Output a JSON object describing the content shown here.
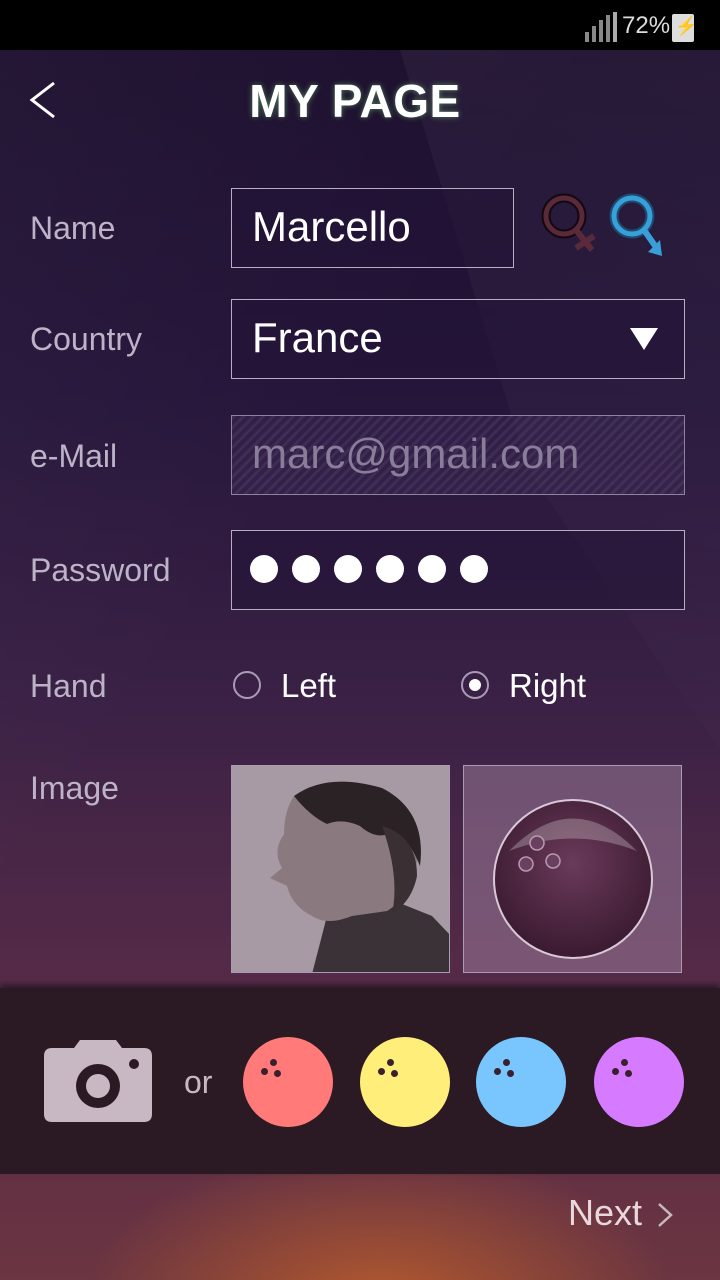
{
  "status": {
    "battery": "72%"
  },
  "header": {
    "title": "MY PAGE"
  },
  "form": {
    "name_label": "Name",
    "name_value": "Marcello",
    "country_label": "Country",
    "country_value": "France",
    "email_label": "e-Mail",
    "email_placeholder": "marc@gmail.com",
    "password_label": "Password",
    "password_length": 6,
    "hand_label": "Hand",
    "hand_options": [
      "Left",
      "Right"
    ],
    "hand_selected": "Right",
    "image_label": "Image"
  },
  "gender": {
    "female_color": "#5a2a3a",
    "male_color": "#3a9ed8",
    "selected": "male"
  },
  "picker": {
    "or_label": "or",
    "ball_colors": [
      "#ff7a78",
      "#ffef7a",
      "#79c6ff",
      "#d67bff"
    ]
  },
  "footer": {
    "next_label": "Next"
  }
}
